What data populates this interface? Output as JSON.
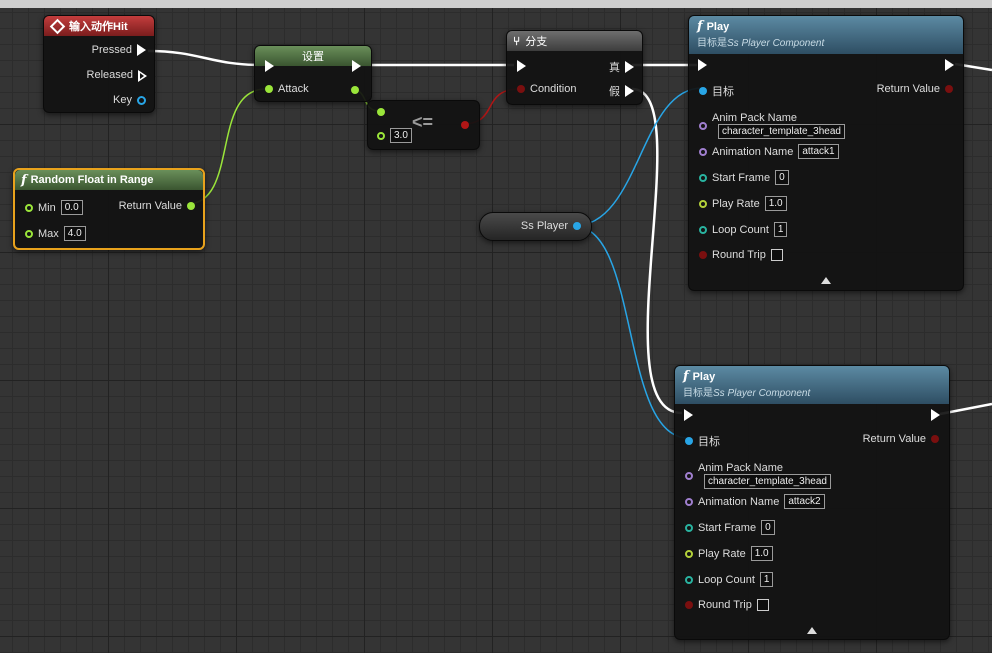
{
  "input_event": {
    "title": "输入动作Hit",
    "pins": [
      "Pressed",
      "Released",
      "Key"
    ]
  },
  "set_node": {
    "title": "设置",
    "pin": "Attack"
  },
  "compare_node": {
    "op": "<=",
    "value": "3.0"
  },
  "branch_node": {
    "title": "分支",
    "true_label": "真",
    "false_label": "假",
    "condition_label": "Condition"
  },
  "random_node": {
    "title": "Random Float in Range",
    "min_label": "Min",
    "min_value": "0.0",
    "max_label": "Max",
    "max_value": "4.0",
    "return_label": "Return Value"
  },
  "ss_player": {
    "label": "Ss Player"
  },
  "play1": {
    "title": "Play",
    "subtitle_prefix": "目标是",
    "subtitle_italic": "Ss Player Component",
    "target_label": "目标",
    "return_label": "Return Value",
    "anim_pack_label": "Anim Pack Name",
    "anim_pack_value": "character_template_3head",
    "animation_label": "Animation Name",
    "animation_value": "attack1",
    "start_frame_label": "Start Frame",
    "start_frame_value": "0",
    "play_rate_label": "Play Rate",
    "play_rate_value": "1.0",
    "loop_count_label": "Loop Count",
    "loop_count_value": "1",
    "round_trip_label": "Round Trip"
  },
  "play2": {
    "title": "Play",
    "subtitle_prefix": "目标是",
    "subtitle_italic": "Ss Player Component",
    "target_label": "目标",
    "return_label": "Return Value",
    "anim_pack_label": "Anim Pack Name",
    "anim_pack_value": "character_template_3head",
    "animation_label": "Animation Name",
    "animation_value": "attack2",
    "start_frame_label": "Start Frame",
    "start_frame_value": "0",
    "play_rate_label": "Play Rate",
    "play_rate_value": "1.0",
    "loop_count_label": "Loop Count",
    "loop_count_value": "1",
    "round_trip_label": "Round Trip"
  },
  "colors": {
    "exec": "#ffffff",
    "float": "#9ae53a",
    "object": "#28a5e6",
    "bool": "#b01616",
    "name": "#a07fcf",
    "int": "#29b3a0",
    "selection": "#e8a21c"
  }
}
